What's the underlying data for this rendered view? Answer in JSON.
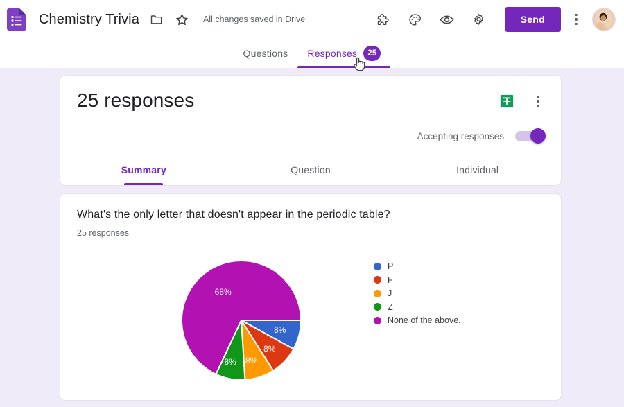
{
  "header": {
    "logo_icon": "google-forms-icon",
    "doc_title": "Chemistry Trivia",
    "move_folder_icon": "folder-icon",
    "star_icon": "star-icon",
    "save_status": "All changes saved in Drive",
    "addons_icon": "puzzle-piece-icon",
    "theme_icon": "palette-icon",
    "preview_icon": "eye-icon",
    "settings_icon": "gear-icon",
    "send_label": "Send",
    "more_icon": "three-dot-menu-icon",
    "avatar_icon": "user-avatar"
  },
  "main_tabs": [
    {
      "label": "Questions",
      "active": false,
      "badge": null
    },
    {
      "label": "Responses",
      "active": true,
      "badge": "25"
    }
  ],
  "summary_card": {
    "response_count_label": "25 responses",
    "sheets_icon": "google-sheets-icon",
    "more_icon": "three-dot-menu-icon",
    "accepting_label": "Accepting responses",
    "accepting_on": true,
    "sub_tabs": [
      {
        "label": "Summary",
        "active": true
      },
      {
        "label": "Question",
        "active": false
      },
      {
        "label": "Individual",
        "active": false
      }
    ]
  },
  "question_card": {
    "title": "What's the only letter that doesn't appear in the periodic table?",
    "response_count_label": "25 responses"
  },
  "colors": {
    "accent": "#7627BB",
    "page_background": "#F0EBF8",
    "sheets_green": "#0F9D58"
  },
  "chart_data": {
    "type": "pie",
    "title": "What's the only letter that doesn't appear in the periodic table?",
    "subtitle": "25 responses",
    "legend_position": "right",
    "total_responses": 25,
    "categories": [
      "P",
      "F",
      "J",
      "Z",
      "None of the above."
    ],
    "values": [
      8,
      8,
      8,
      8,
      68
    ],
    "value_unit": "percent",
    "data_labels": [
      "8%",
      "8%",
      "8%",
      "8%",
      "68%"
    ],
    "colors": [
      "#3366CC",
      "#DC3912",
      "#FF9900",
      "#109618",
      "#B112B1"
    ],
    "start_angle_deg": 0,
    "direction": "clockwise"
  }
}
